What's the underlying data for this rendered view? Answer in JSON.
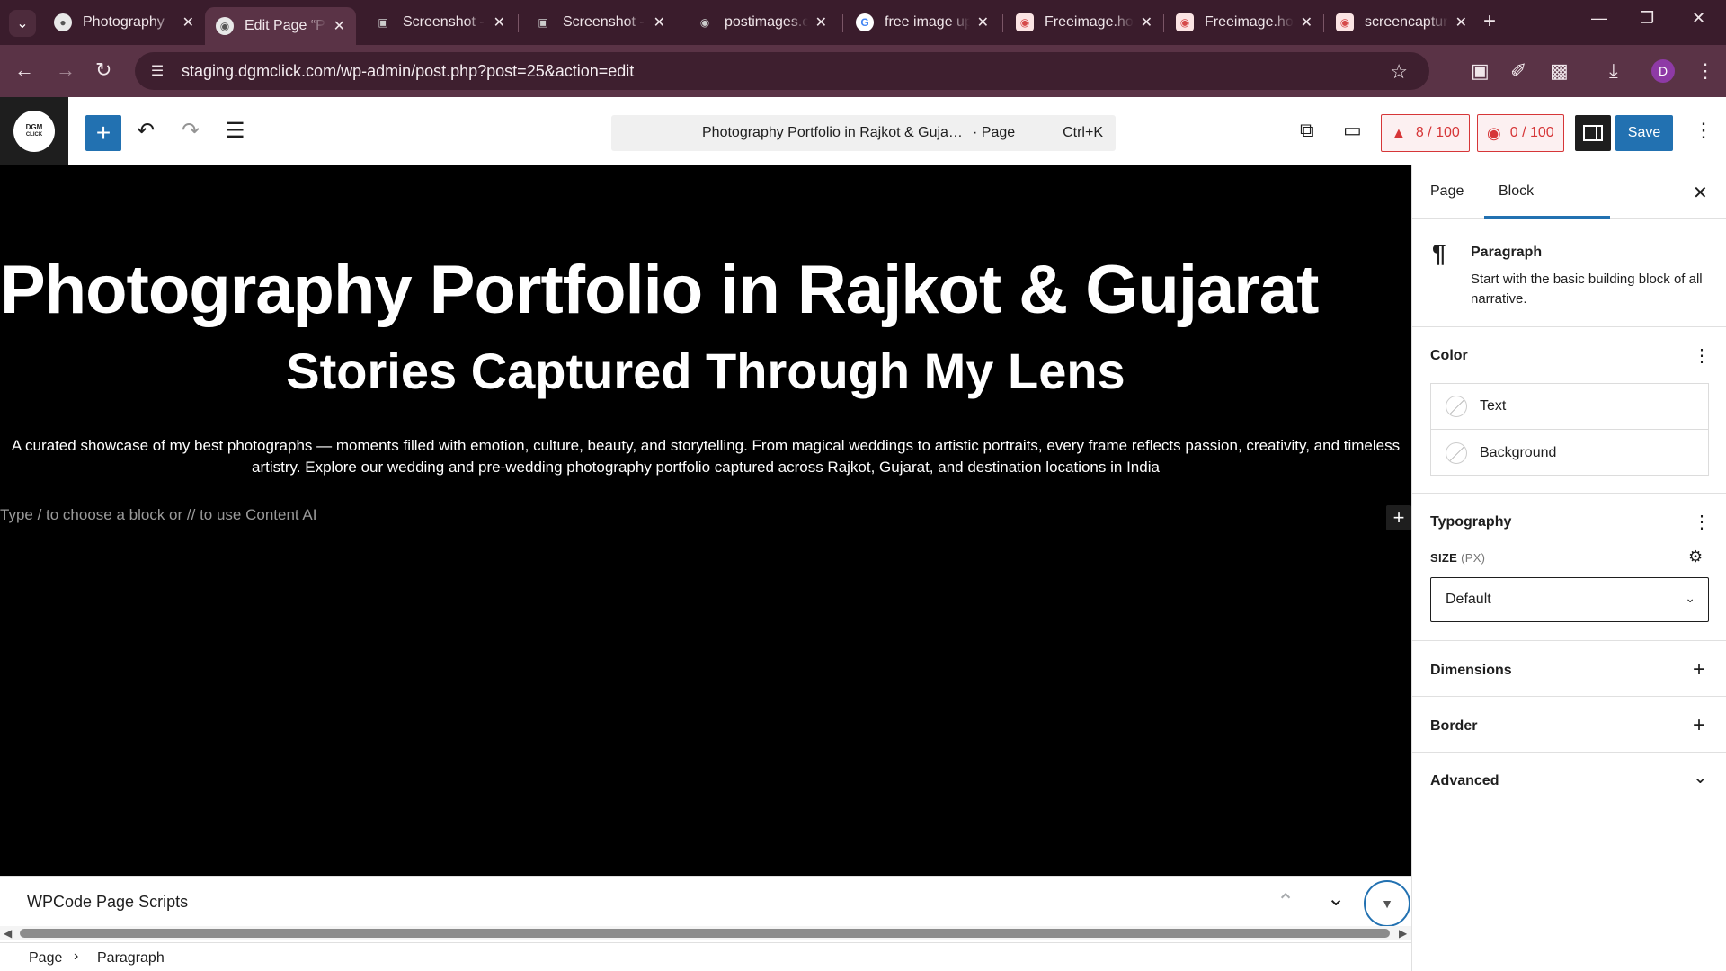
{
  "browser": {
    "tabs": [
      {
        "label": "Photography",
        "favicon": "globe-icon",
        "active": false
      },
      {
        "label": "Edit Page “Photography",
        "favicon": "wp-icon",
        "active": true
      },
      {
        "label": "Screenshot -",
        "favicon": "camera-icon",
        "active": false
      },
      {
        "label": "Screenshot -",
        "favicon": "camera-icon",
        "active": false
      },
      {
        "label": "postimages.org",
        "favicon": "globe-icon",
        "active": false
      },
      {
        "label": "free image upload",
        "favicon": "google-icon",
        "active": false
      },
      {
        "label": "Freeimage.host",
        "favicon": "freeimage-icon",
        "active": false
      },
      {
        "label": "Freeimage.host",
        "favicon": "freeimage-icon",
        "active": false
      },
      {
        "label": "screencapture",
        "favicon": "freeimage-icon",
        "active": false
      }
    ],
    "url": "staging.dgmclick.com/wp-admin/post.php?post=25&action=edit",
    "profile_initial": "D"
  },
  "header": {
    "logo_line1": "DGM",
    "logo_line2": "CLICK",
    "doc_title": "Photography Portfolio in Rajkot & Guja…",
    "doc_type": "· Page",
    "shortcut": "Ctrl+K",
    "seo_score": "8 / 100",
    "content_score": "0 / 100",
    "save_label": "Save"
  },
  "canvas": {
    "heading": "Photography Portfolio in Rajkot & Gujarat",
    "subheading": "Stories Captured Through My Lens",
    "paragraph_line1": "A curated showcase of my best photographs — moments filled with emotion, culture, beauty, and storytelling. From magical weddings to artistic portraits, every frame reflects passion, creativity, and timeless",
    "paragraph_line2": "artistry. Explore our wedding and pre-wedding photography portfolio captured across Rajkot, Gujarat, and destination locations in India",
    "placeholder": "Type / to choose a block or // to use Content AI"
  },
  "metabox": {
    "title": "WPCode Page Scripts"
  },
  "footer": {
    "crumb_page": "Page",
    "crumb_block": "Paragraph"
  },
  "sidebar": {
    "tab_page": "Page",
    "tab_block": "Block",
    "block_name": "Paragraph",
    "block_desc": "Start with the basic building block of all narrative.",
    "color_title": "Color",
    "color_text": "Text",
    "color_background": "Background",
    "typography_title": "Typography",
    "size_label": "SIZE",
    "size_unit": "(PX)",
    "size_value": "Default",
    "dimensions_title": "Dimensions",
    "border_title": "Border",
    "advanced_title": "Advanced"
  },
  "colors": {
    "wp_blue": "#2271b1",
    "browser_frame": "#3a1c2c",
    "score_red": "#d63638"
  }
}
